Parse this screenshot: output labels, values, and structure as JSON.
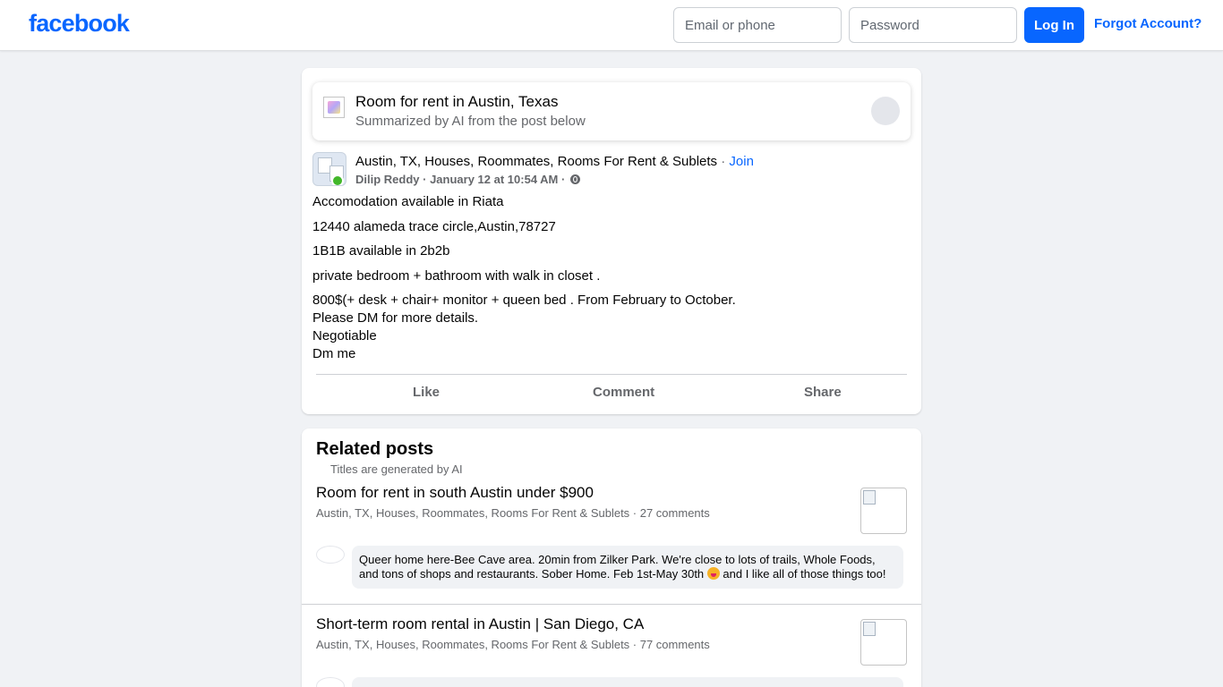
{
  "header": {
    "logo": "facebook",
    "email_placeholder": "Email or phone",
    "password_placeholder": "Password",
    "login_label": "Log In",
    "forgot_label": "Forgot Account?"
  },
  "summary": {
    "title": "Room for rent in Austin, Texas",
    "subtitle": "Summarized by AI from the post below"
  },
  "post": {
    "group_name": "Austin, TX, Houses, Roommates, Rooms For Rent & Sublets",
    "separator": " · ",
    "join_label": "Join",
    "author": "Dilip Reddy",
    "timestamp": "January 12 at 10:54 AM",
    "lines": [
      "Accomodation available in Riata",
      "12440 alameda trace circle,Austin,78727",
      "1B1B available in 2b2b",
      "private bedroom + bathroom with walk in closet  .",
      "800$(+ desk + chair+ monitor + queen bed . From February to October.",
      "Please DM for more details.",
      "Negotiable",
      "Dm me"
    ],
    "actions": {
      "like": "Like",
      "comment": "Comment",
      "share": "Share"
    }
  },
  "related": {
    "heading": "Related posts",
    "subheading": "Titles are generated by AI",
    "items": [
      {
        "title": "Room for rent in south Austin under $900",
        "meta": "Austin, TX, Houses, Roommates, Rooms For Rent & Sublets · 27 comments",
        "snippet_before": "Queer home here-Bee Cave area. 20min from Zilker Park. We're close to lots of trails, Whole Foods, and tons of shops and restaurants. Sober Home. Feb 1st-May 30th ",
        "snippet_after": " and I like all of those things too!"
      },
      {
        "title": "Short-term room rental in Austin | San Diego, CA",
        "meta": "Austin, TX, Houses, Roommates, Rooms For Rent & Sublets · 77 comments"
      }
    ]
  }
}
